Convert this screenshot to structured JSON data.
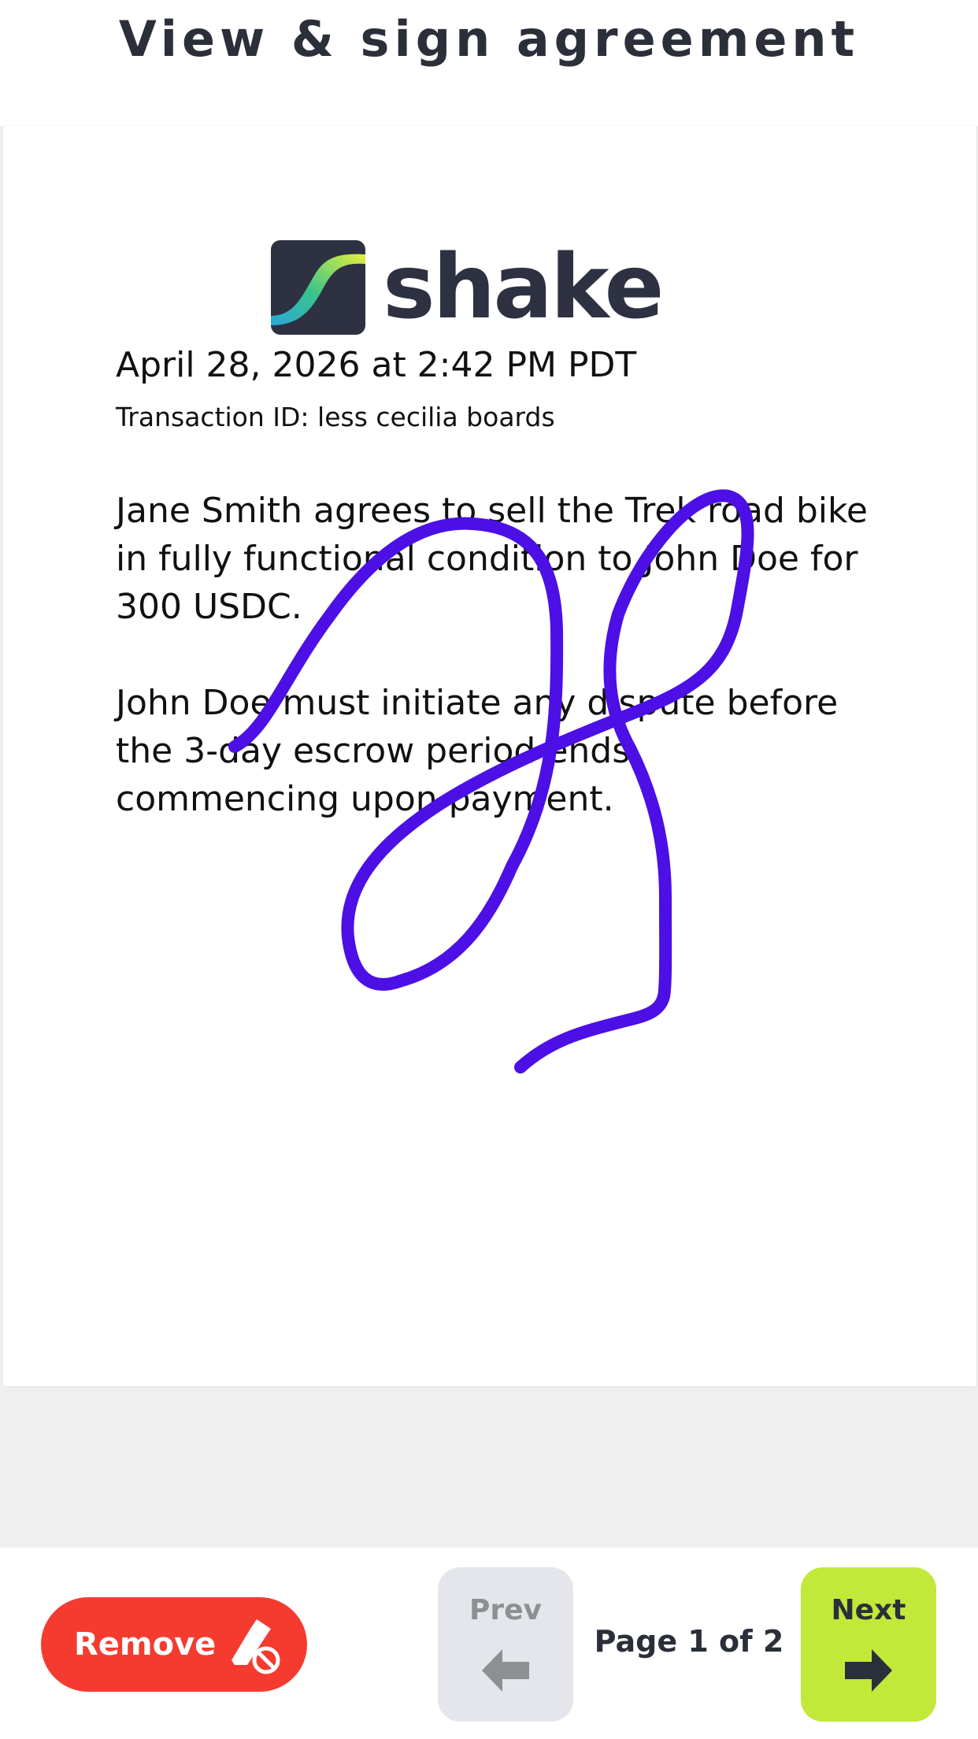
{
  "header": {
    "title": "View & sign agreement"
  },
  "document": {
    "logo_text": "shake",
    "date": "April 28, 2026 at 2:42 PM PDT",
    "transaction_id": "Transaction ID: less cecilia boards",
    "paragraphs": [
      "Jane Smith agrees to sell the Trek road bike in fully functional condition to John Doe for 300 USDC.",
      "John Doe must initiate any dispute before the 3-day escrow period ends, commencing upon payment."
    ],
    "signature_color": "#4c0fe6"
  },
  "footer": {
    "remove_label": "Remove",
    "remove_icon": "eraser-icon",
    "prev_label": "Prev",
    "prev_icon": "arrow-left-icon",
    "next_label": "Next",
    "next_icon": "arrow-right-icon",
    "page_indicator": "Page 1 of 2",
    "current_page": 1,
    "total_pages": 2
  },
  "colors": {
    "remove": "#f53b30",
    "next": "#c2e83a",
    "prev": "#e4e6eb",
    "text": "#2b2f3a"
  }
}
